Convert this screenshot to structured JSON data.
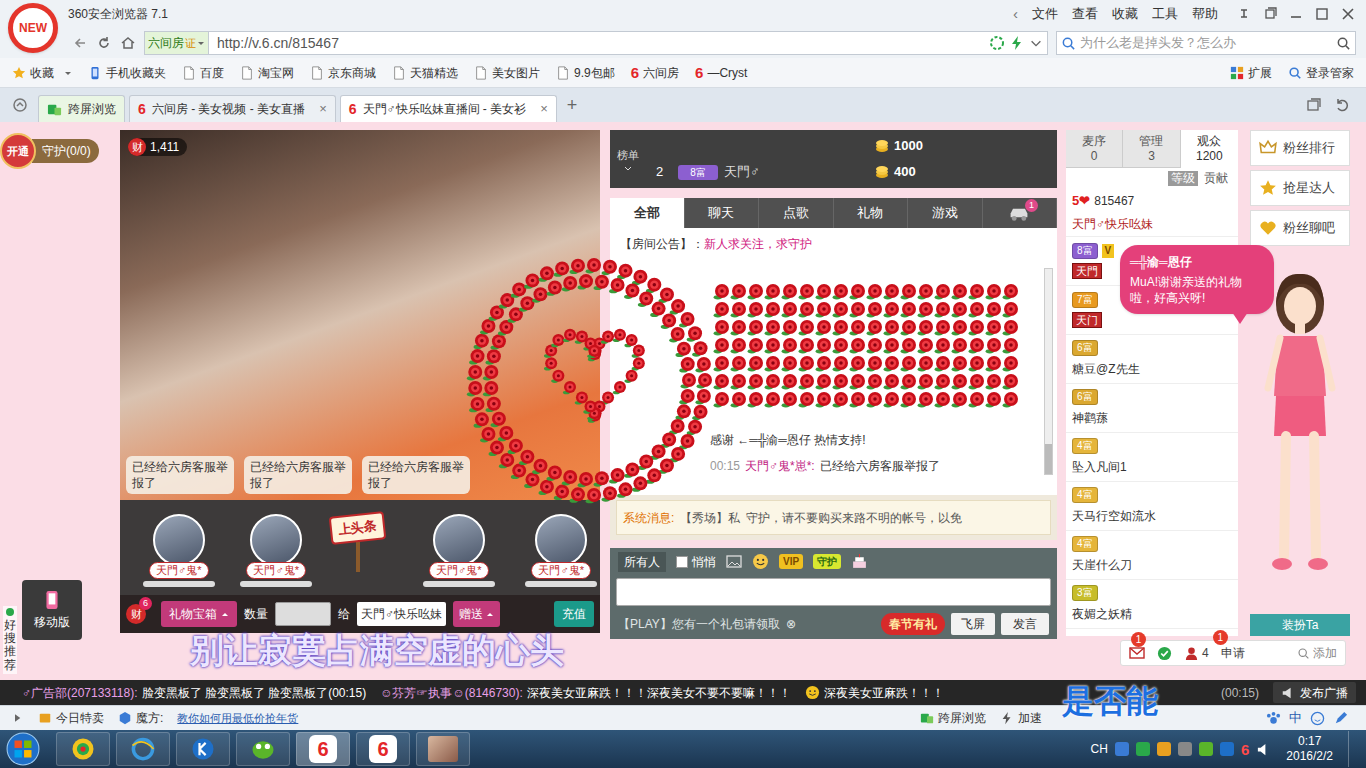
{
  "browser": {
    "logo": "NEW",
    "title": "360安全浏览器 7.1",
    "menu_arrow": "‹",
    "menu": [
      "文件",
      "查看",
      "收藏",
      "工具",
      "帮助"
    ],
    "site_badge": "六间房",
    "cert": "证",
    "url": "http://v.6.cn/815467",
    "search_placeholder": "为什么老是掉头发？怎么办",
    "six_logo": "6"
  },
  "bookmarks": [
    {
      "label": "收藏",
      "kind": "star"
    },
    {
      "label": "手机收藏夹",
      "kind": "phone"
    },
    {
      "label": "百度",
      "kind": "page"
    },
    {
      "label": "淘宝网",
      "kind": "page"
    },
    {
      "label": "京东商城",
      "kind": "page"
    },
    {
      "label": "天猫精选",
      "kind": "page"
    },
    {
      "label": "美女图片",
      "kind": "page"
    },
    {
      "label": "9.9包邮",
      "kind": "page"
    },
    {
      "label": "六间房",
      "kind": "six"
    },
    {
      "label": "—Cryst",
      "kind": "six"
    }
  ],
  "bookmark_tools": [
    "扩展",
    "登录管家"
  ],
  "tabs": [
    {
      "label": "跨屏浏览",
      "kind": "cross",
      "selected": false
    },
    {
      "label": "六间房 - 美女视频 - 美女直播",
      "kind": "six",
      "selected": false
    },
    {
      "label": "天門♂快乐吆妹直播间 - 美女衫",
      "kind": "six",
      "selected": true
    }
  ],
  "tab_close": "×",
  "new_tab": "+",
  "room": {
    "guard_open": "开通",
    "guard": "守护(0/0)",
    "wealth_icon": "财",
    "wealth": "1,411",
    "gift_messages": [
      "已经给六房客服举报了",
      "已经给六房客服举报了",
      "已经给六房客服举报了"
    ],
    "avatars": [
      "天門♂鬼*",
      "天門♂鬼*",
      "天門♂鬼*",
      "天門♂鬼*"
    ],
    "headline": "上头条",
    "gift_bar": {
      "wealth_icon": "财",
      "wealth_badge": "6",
      "box": "礼物宝箱",
      "qty_label": "数量",
      "to_label": "给",
      "recipient": "天門♂快乐吆妹",
      "send": "赠送",
      "recharge": "充值"
    },
    "mobile": "移动版",
    "recommend": "好搜推荐"
  },
  "rank": {
    "label": "榜单",
    "rows": [
      {
        "no": "",
        "level": "",
        "name": "",
        "amount": "1000",
        "color": "#3f3f3f"
      },
      {
        "no": "2",
        "level": "8富",
        "name": "天門♂",
        "amount": "400",
        "color": "#8c5fd0"
      }
    ]
  },
  "chat": {
    "tabs": [
      {
        "label": "全部",
        "kind": "text",
        "badge": "",
        "selected": true
      },
      {
        "label": "聊天",
        "kind": "text",
        "badge": "",
        "selected": false
      },
      {
        "label": "点歌",
        "kind": "text",
        "badge": "",
        "selected": false
      },
      {
        "label": "礼物",
        "kind": "text",
        "badge": "",
        "selected": false
      },
      {
        "label": "游戏",
        "kind": "text",
        "badge": "",
        "selected": false
      },
      {
        "label": "",
        "kind": "car",
        "badge": "1",
        "selected": false
      }
    ],
    "announcement_label": "【房间公告】：",
    "announcement": "新人求关注，求守护",
    "messages": [
      {
        "time": "",
        "user": "",
        "text": "感谢 ←═╬渝═恩仔 热情支持!"
      },
      {
        "time": "00:15",
        "user": "天門♂鬼*崽*:",
        "text": "已经给六房客服举报了"
      }
    ],
    "system_label": "系统消息:",
    "system": [
      "【秀场】私",
      "守护，请不要购买来路不明的帐号，以免"
    ],
    "target": "所有人",
    "whisper": {
      "label": "悄悄",
      "checked": false
    },
    "vip": "VIP",
    "guard": "守护",
    "play": "【PLAY】您有一个礼包请领取",
    "play_close": "⊗",
    "spring": "春节有礼",
    "fly": "飞屏",
    "send": "发言"
  },
  "audience": {
    "tabs": [
      {
        "label": "麦序",
        "count": "0",
        "selected": false
      },
      {
        "label": "管理",
        "count": "3",
        "selected": false
      },
      {
        "label": "观众",
        "count": "1200",
        "selected": true
      }
    ],
    "header": [
      "等级",
      "贡献"
    ],
    "users": [
      {
        "kind": "host",
        "level": "5❤",
        "id": "815467",
        "name": "天門♂快乐吆妹",
        "color": "#e02020"
      },
      {
        "kind": "fan",
        "level": "8富",
        "badge": "V",
        "tag": "天門",
        "name": "",
        "color": "#8c5fd0"
      },
      {
        "kind": "fan",
        "level": "7富",
        "badge": "",
        "tag": "天门",
        "name": "",
        "color": "#e89a20"
      },
      {
        "kind": "fan",
        "level": "6富",
        "badge": "",
        "tag": "",
        "name": "糖豆@Z先生",
        "color": "#dba830"
      },
      {
        "kind": "fan",
        "level": "6富",
        "badge": "",
        "tag": "",
        "name": "神鹳蓀",
        "color": "#dba830"
      },
      {
        "kind": "fan",
        "level": "4富",
        "badge": "",
        "tag": "",
        "name": "坠入凡间1",
        "color": "#e5b53a"
      },
      {
        "kind": "fan",
        "level": "4富",
        "badge": "",
        "tag": "",
        "name": "天马行空如流水",
        "color": "#e5b53a"
      },
      {
        "kind": "fan",
        "level": "4富",
        "badge": "",
        "tag": "",
        "name": "天崖什么刀",
        "color": "#e5b53a"
      },
      {
        "kind": "fan",
        "level": "3富",
        "badge": "",
        "tag": "",
        "name": "夜媚之妖精",
        "color": "#c7bd2a"
      }
    ]
  },
  "bubble": {
    "user": "═╬渝═恩仔",
    "text": "MuA!谢谢亲送的礼物啦，好高兴呀!"
  },
  "side_buttons": [
    "粉丝排行",
    "抢星达人",
    "粉丝聊吧"
  ],
  "dress": "装扮Ta",
  "bottom_icons": {
    "mail_badge": "1",
    "people": "4",
    "apply": "申请",
    "apply_badge": "1",
    "add": "添加"
  },
  "ticker": {
    "items": [
      {
        "user": "♂广告部(207133118):",
        "text": "脸变黑板了 脸变黑板了 脸变黑板了(00:15)"
      },
      {
        "user": "☺芬芳☞执事☺(8146730):",
        "text": "深夜美女亚麻跌！！！深夜美女不要不要嘛！！！"
      },
      {
        "user": "",
        "text": "深夜美女亚麻跌！！！"
      }
    ],
    "time": "(00:15)",
    "broadcast": "发布广播"
  },
  "lyrics": [
    "别让寂寞占满空虚的心头",
    "是否能"
  ],
  "status_bar": {
    "left": [
      "今日特卖",
      "魔方:"
    ],
    "promo": "教你如何用最低价抢年货",
    "right": [
      "跨屏浏览",
      "加速"
    ],
    "ime": "中"
  },
  "taskbar": {
    "lang": "CH",
    "time": "0:17",
    "date": "2016/2/2"
  }
}
